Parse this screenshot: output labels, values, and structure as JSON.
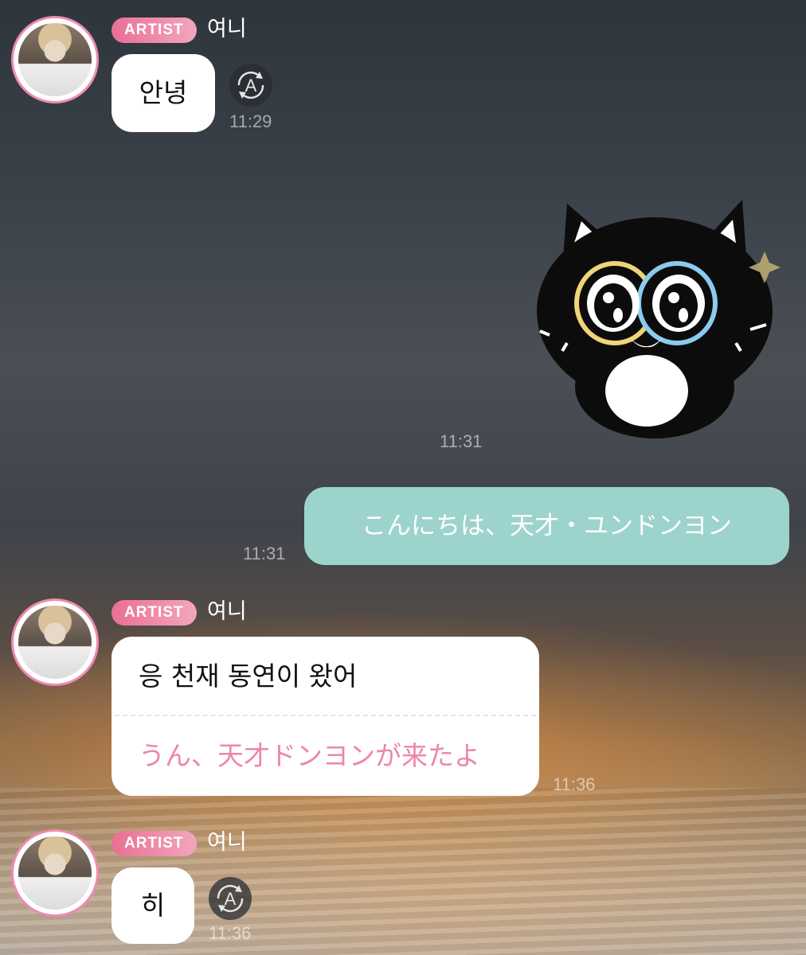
{
  "messages": [
    {
      "badge": "ARTIST",
      "sender": "여니",
      "text": "안녕",
      "time": "11:29"
    },
    {
      "sticker": "black-cat-sticker",
      "time": "11:31"
    },
    {
      "text": "こんにちは、天才・ユンドンヨン",
      "time": "11:31"
    },
    {
      "badge": "ARTIST",
      "sender": "여니",
      "text": "응 천재 동연이 왔어",
      "translation": "うん、天才ドンヨンが来たよ",
      "time": "11:36"
    },
    {
      "badge": "ARTIST",
      "sender": "여니",
      "text": "히",
      "time": "11:36"
    }
  ],
  "icons": {
    "translate": "A",
    "translate_icon": "auto-translate-icon",
    "avatar": "artist-avatar"
  },
  "colors": {
    "badge_pink": "#ea6f95",
    "my_bubble": "#9dd3cd",
    "translation_text": "#ee86a9",
    "avatar_ring": "#ee8bb0"
  }
}
